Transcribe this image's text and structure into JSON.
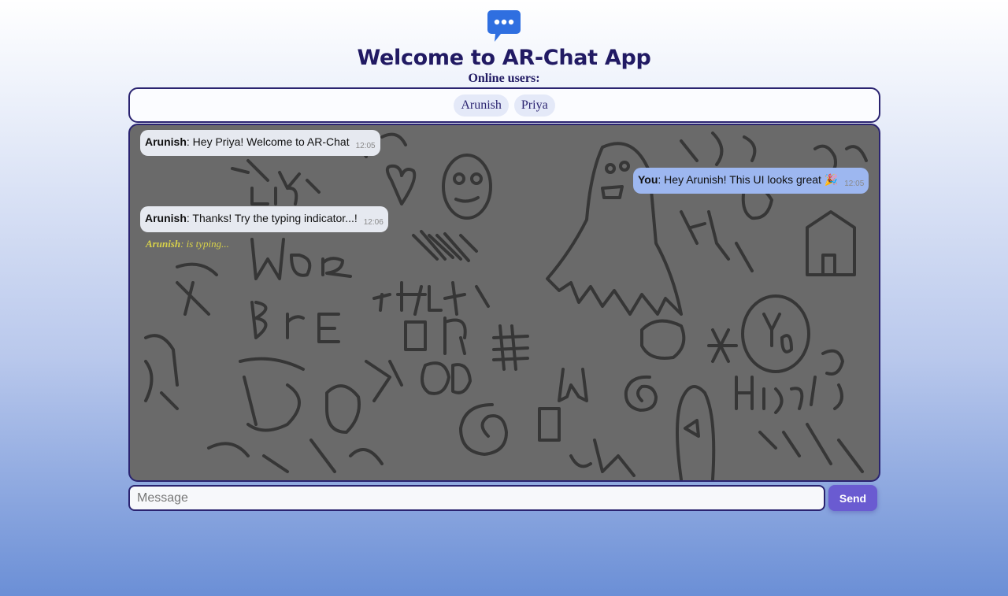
{
  "app": {
    "logo_icon": "chat-bubble-icon",
    "title": "Welcome to AR-Chat App"
  },
  "online": {
    "label": "Online users:",
    "users": [
      "Arunish",
      "Priya"
    ]
  },
  "messages": [
    {
      "sender": "Arunish",
      "text": ": Hey Priya! Welcome to AR-Chat",
      "time": "12:05",
      "mine": false
    },
    {
      "sender": "You",
      "text": ": Hey Arunish! This UI looks great 🎉",
      "time": "12:05",
      "mine": true
    },
    {
      "sender": "Arunish",
      "text": ": Thanks! Try the typing indicator...!",
      "time": "12:06",
      "mine": false
    }
  ],
  "typing": {
    "who": "Arunish",
    "text": ": is typing..."
  },
  "composer": {
    "placeholder": "Message",
    "value": "",
    "send_label": "Send"
  },
  "colors": {
    "accent": "#6a5bd1",
    "title": "#211a63",
    "own_bubble": "#9db7f0",
    "other_bubble": "#e6e9f0",
    "typing": "#d8d24a"
  }
}
